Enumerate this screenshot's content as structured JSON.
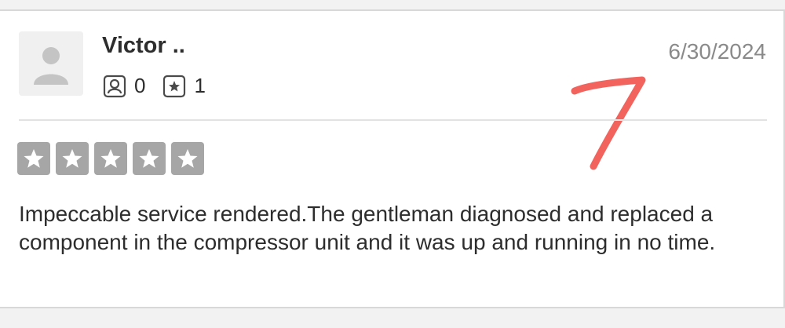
{
  "review": {
    "reviewer_name": "Victor ..",
    "friends_count": "0",
    "reviews_count": "1",
    "date": "6/30/2024",
    "rating": 5,
    "text": "Impeccable service rendered.The gentleman diagnosed and replaced a component in the compressor unit and it was up and running in no time."
  },
  "annotation": {
    "handwritten_mark": "7",
    "color": "#f0524a"
  },
  "colors": {
    "star_box": "#a6a6a6",
    "text": "#2d2d2d",
    "date": "#8a8a8a"
  }
}
